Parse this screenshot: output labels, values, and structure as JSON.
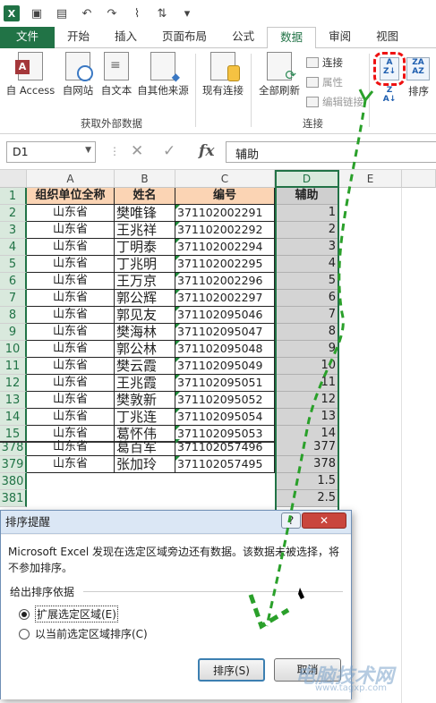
{
  "qat": {
    "icons": [
      "excel-logo",
      "save-icon",
      "save-as-icon",
      "undo-icon",
      "redo-icon",
      "format-painter-icon",
      "customize-icon"
    ]
  },
  "tabs": [
    {
      "label": "文件"
    },
    {
      "label": "开始"
    },
    {
      "label": "插入"
    },
    {
      "label": "页面布局"
    },
    {
      "label": "公式"
    },
    {
      "label": "数据"
    },
    {
      "label": "审阅"
    },
    {
      "label": "视图"
    }
  ],
  "active_tab": "数据",
  "ribbon": {
    "get_external": {
      "buttons": [
        "自 Access",
        "自网站",
        "自文本",
        "自其他来源"
      ],
      "group_label": "获取外部数据"
    },
    "existing_conn": "现有连接",
    "connections": {
      "refresh_all": "全部刷新",
      "connect": "连接",
      "properties": "属性",
      "edit_links": "编辑链接",
      "group_label": "连接"
    },
    "sort": {
      "sort_label": "排序",
      "az": "A Z",
      "za": "Z A"
    }
  },
  "formula_bar": {
    "name_box": "D1",
    "cancel": "✕",
    "enter": "✓",
    "fx": "fx",
    "value": "辅助"
  },
  "columns": [
    "A",
    "B",
    "C",
    "D",
    "E"
  ],
  "header_row": {
    "a": "组织单位全称",
    "b": "姓名",
    "c": "编号",
    "d": "辅助"
  },
  "rows": [
    {
      "r": "2",
      "a": "山东省",
      "b": "樊唯锋",
      "c": "371102002291",
      "d": "1"
    },
    {
      "r": "3",
      "a": "山东省",
      "b": "王兆祥",
      "c": "371102002292",
      "d": "2"
    },
    {
      "r": "4",
      "a": "山东省",
      "b": "丁明泰",
      "c": "371102002294",
      "d": "3"
    },
    {
      "r": "5",
      "a": "山东省",
      "b": "丁兆明",
      "c": "371102002295",
      "d": "4"
    },
    {
      "r": "6",
      "a": "山东省",
      "b": "王万京",
      "c": "371102002296",
      "d": "5"
    },
    {
      "r": "7",
      "a": "山东省",
      "b": "郭公辉",
      "c": "371102002297",
      "d": "6"
    },
    {
      "r": "8",
      "a": "山东省",
      "b": "郭见友",
      "c": "371102095046",
      "d": "7"
    },
    {
      "r": "9",
      "a": "山东省",
      "b": "樊海林",
      "c": "371102095047",
      "d": "8"
    },
    {
      "r": "10",
      "a": "山东省",
      "b": "郭公林",
      "c": "371102095048",
      "d": "9"
    },
    {
      "r": "11",
      "a": "山东省",
      "b": "樊云霞",
      "c": "371102095049",
      "d": "10"
    },
    {
      "r": "12",
      "a": "山东省",
      "b": "王兆霞",
      "c": "371102095051",
      "d": "11"
    },
    {
      "r": "13",
      "a": "山东省",
      "b": "樊敦新",
      "c": "371102095052",
      "d": "12"
    },
    {
      "r": "14",
      "a": "山东省",
      "b": "丁兆连",
      "c": "371102095054",
      "d": "13"
    },
    {
      "r": "15",
      "a": "山东省",
      "b": "葛怀伟",
      "c": "371102095053",
      "d": "14"
    },
    {
      "r": "378",
      "a": "山东省",
      "b": "葛百军",
      "c": "371102057496",
      "d": "377"
    },
    {
      "r": "379",
      "a": "山东省",
      "b": "张加玲",
      "c": "371102057495",
      "d": "378"
    },
    {
      "r": "380",
      "a": "",
      "b": "",
      "c": "",
      "d": "1.5"
    },
    {
      "r": "381",
      "a": "",
      "b": "",
      "c": "",
      "d": "2.5"
    }
  ],
  "dialog": {
    "title": "排序提醒",
    "help": "?",
    "close": "✕",
    "message": "Microsoft Excel 发现在选定区域旁边还有数据。该数据未被选择，将不参加排序。",
    "fieldset": "给出排序依据",
    "opt1": "扩展选定区域(E)",
    "opt2": "以当前选定区域排序(C)",
    "opt1_checked": true,
    "sort_btn": "排序(S)",
    "cancel_btn": "取消"
  },
  "watermark": {
    "text": "电脑技术网",
    "sub": "www.tagxp.com"
  },
  "colors": {
    "excel_green": "#217346",
    "header_fill": "#fbd4b4",
    "arrow": "#2aa02a",
    "highlight": "#e11111"
  }
}
